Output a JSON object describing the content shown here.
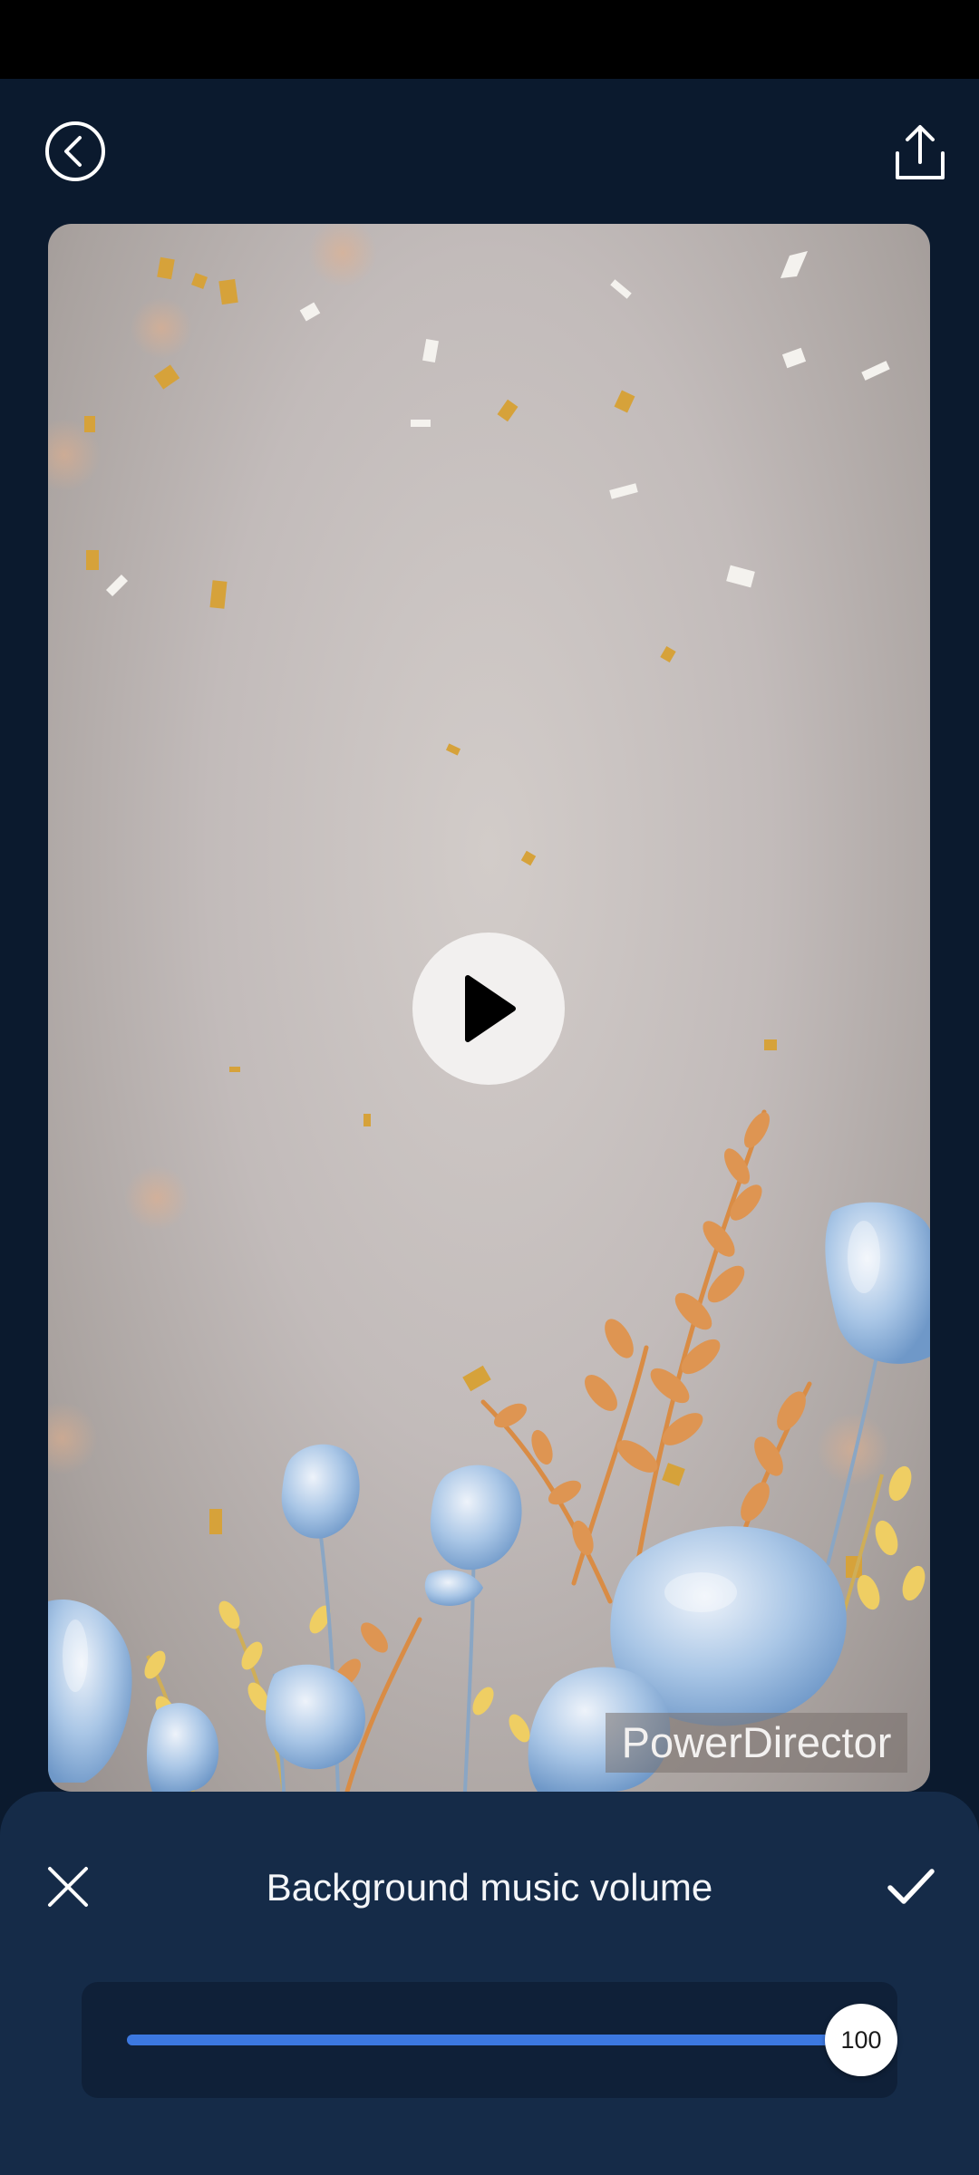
{
  "app": {
    "icons": {
      "back": "back-chevron-circle-icon",
      "share": "share-upload-icon",
      "play": "play-icon",
      "close": "close-x-icon",
      "confirm": "checkmark-icon"
    }
  },
  "preview": {
    "watermark": "PowerDirector",
    "background_color": "#c8c2c0"
  },
  "volume_panel": {
    "title": "Background music volume",
    "volume_value": "100",
    "volume_fraction": 1.0,
    "accent_color": "#3c78e0",
    "panel_color": "#152b48"
  }
}
